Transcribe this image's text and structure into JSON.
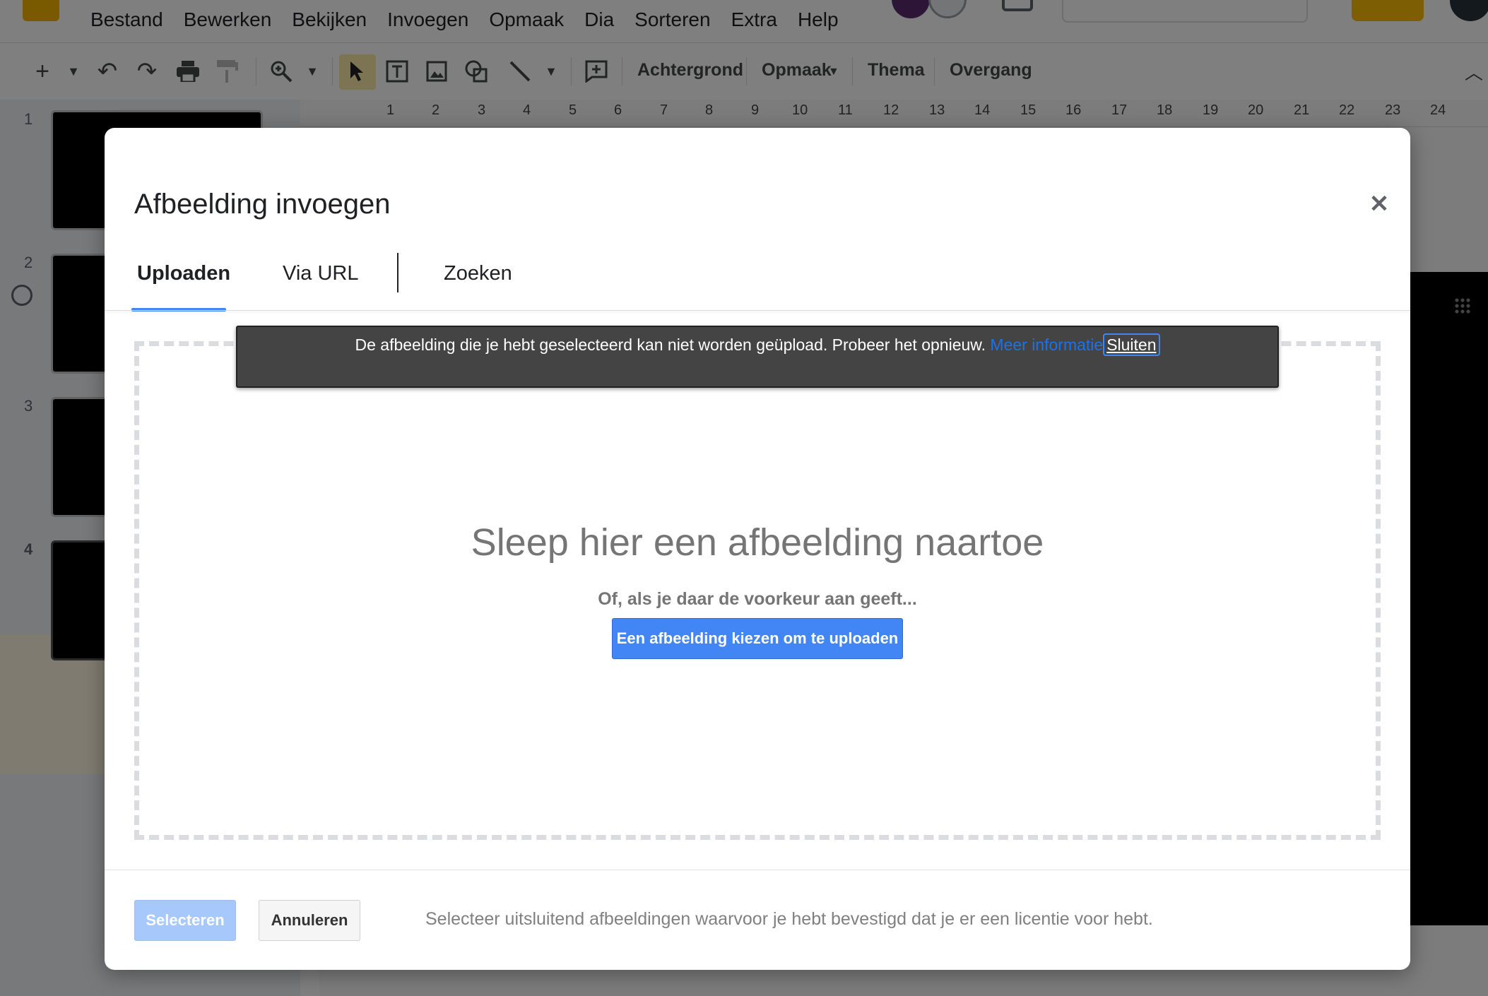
{
  "app": {
    "menus": [
      "Bestand",
      "Bewerken",
      "Bekijken",
      "Invoegen",
      "Opmaak",
      "Dia",
      "Sorteren",
      "Extra",
      "Help"
    ],
    "toolbar": {
      "background_label": "Achtergrond",
      "format_label": "Opmaak",
      "theme_label": "Thema",
      "transition_label": "Overgang"
    },
    "ruler_ticks": [
      "1",
      "2",
      "3",
      "4",
      "5",
      "6",
      "7",
      "8",
      "9",
      "10",
      "11",
      "12",
      "13",
      "14",
      "15",
      "16",
      "17",
      "18",
      "19",
      "20",
      "21",
      "22",
      "23",
      "24"
    ],
    "slide_numbers": [
      "1",
      "2",
      "3",
      "4"
    ]
  },
  "dialog": {
    "title": "Afbeelding invoegen",
    "tabs": [
      {
        "label": "Uploaden",
        "active": true
      },
      {
        "label": "Via URL",
        "active": false
      },
      {
        "label": "Zoeken",
        "active": false
      }
    ],
    "toast": {
      "message": "De afbeelding die je hebt geselecteerd kan niet worden geüpload. Probeer het opnieuw.",
      "more_link": "Meer informatie",
      "close_label": "Sluiten"
    },
    "dropzone": {
      "heading": "Sleep hier een afbeelding naartoe",
      "subheading": "Of, als je daar de voorkeur aan geeft...",
      "choose_button": "Een afbeelding kiezen om te uploaden"
    },
    "footer": {
      "select_label": "Selecteren",
      "cancel_label": "Annuleren",
      "license_note": "Selecteer uitsluitend afbeeldingen waarvoor je hebt bevestigd dat je er een licentie voor hebt."
    }
  },
  "colors": {
    "accent_blue": "#4285f4",
    "brand_yellow": "#f4b400",
    "toast_bg": "#444444"
  }
}
